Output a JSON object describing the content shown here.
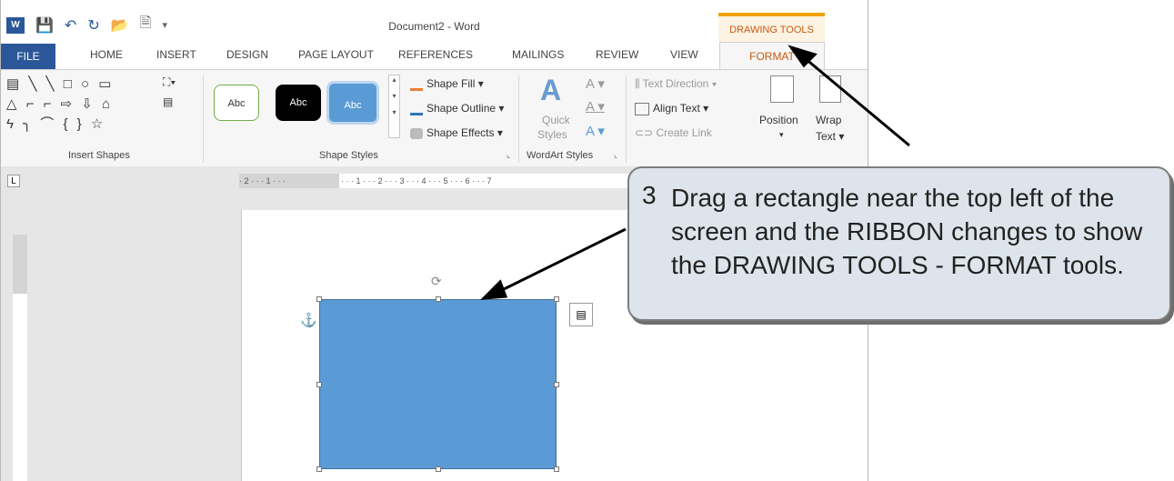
{
  "title": "Document2 - Word",
  "context_tab_group": "DRAWING TOOLS",
  "tabs": [
    "FILE",
    "HOME",
    "INSERT",
    "DESIGN",
    "PAGE LAYOUT",
    "REFERENCES",
    "MAILINGS",
    "REVIEW",
    "VIEW",
    "FORMAT"
  ],
  "groups": {
    "insert_shapes": "Insert Shapes",
    "shape_styles": "Shape Styles",
    "wordart_styles": "WordArt Styles"
  },
  "style_buttons": [
    "Abc",
    "Abc",
    "Abc"
  ],
  "commands": {
    "shape_fill": "Shape Fill",
    "shape_outline": "Shape Outline",
    "shape_effects": "Shape Effects",
    "quick_styles_1": "Quick",
    "quick_styles_2": "Styles",
    "text_direction": "Text Direction",
    "align_text": "Align Text",
    "create_link": "Create Link",
    "position": "Position",
    "wrap_text_1": "Wrap",
    "wrap_text_2": "Text"
  },
  "ruler_corner": "L",
  "hruler_gray_text": "· 2 · · · 1 · · · ",
  "hruler_text": "· · · 1 · · · 2 · · · 3 · · · 4 · · · 5 · · · 6 · · · 7",
  "callout": {
    "number": "3",
    "text": "Drag a rectangle near the top left of the screen and the RIBBON changes to show the DRAWING TOOLS - FORMAT tools."
  },
  "colors": {
    "word_blue": "#2b579a",
    "format_orange": "#c55a11",
    "shape_fill": "#5b9bd5",
    "callout_bg": "#dde4eb"
  }
}
